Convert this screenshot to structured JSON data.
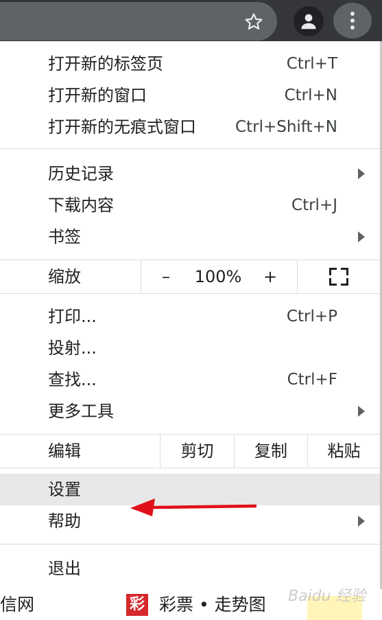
{
  "menu": {
    "new_tab": {
      "label": "打开新的标签页",
      "shortcut": "Ctrl+T"
    },
    "new_window": {
      "label": "打开新的窗口",
      "shortcut": "Ctrl+N"
    },
    "new_incognito": {
      "label": "打开新的无痕式窗口",
      "shortcut": "Ctrl+Shift+N"
    },
    "history": {
      "label": "历史记录"
    },
    "downloads": {
      "label": "下载内容",
      "shortcut": "Ctrl+J"
    },
    "bookmarks": {
      "label": "书签"
    },
    "zoom": {
      "label": "缩放",
      "minus": "–",
      "value": "100%",
      "plus": "+"
    },
    "print": {
      "label": "打印...",
      "shortcut": "Ctrl+P"
    },
    "cast": {
      "label": "投射..."
    },
    "find": {
      "label": "查找...",
      "shortcut": "Ctrl+F"
    },
    "more_tools": {
      "label": "更多工具"
    },
    "edit": {
      "label": "编辑",
      "cut": "剪切",
      "copy": "复制",
      "paste": "粘贴"
    },
    "settings": {
      "label": "设置"
    },
    "help": {
      "label": "帮助"
    },
    "exit": {
      "label": "退出"
    }
  },
  "page_behind": {
    "left_text": "信网",
    "lottery_badge": "彩",
    "lottery_text": "彩票 • 走势图"
  },
  "watermark": {
    "text": "Baidu 经验"
  },
  "colors": {
    "toolbar": "#35363a",
    "omnibox": "#5f6368",
    "highlight": "#e8e8e8",
    "annotation_arrow": "#e0101a",
    "lottery_badge": "#d6282c"
  }
}
